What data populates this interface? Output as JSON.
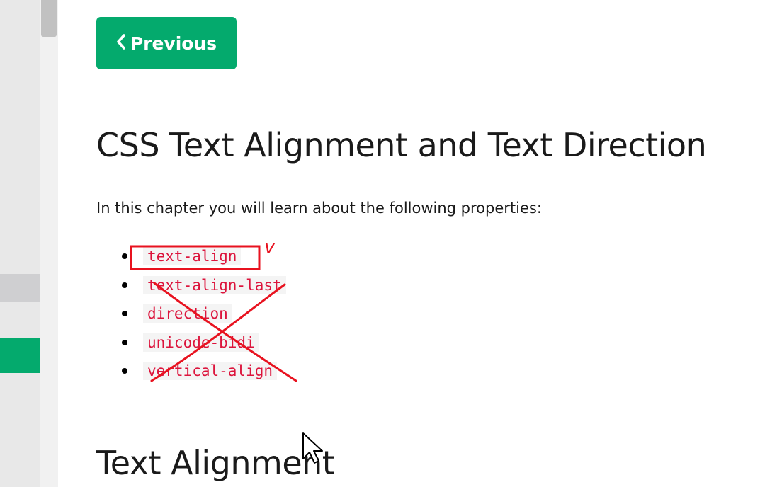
{
  "nav": {
    "previous_label": "Previous",
    "previous_icon": "chevron-left-icon"
  },
  "main": {
    "title": "CSS Text Alignment and Text Direction",
    "intro": "In this chapter you will learn about the following properties:",
    "properties": [
      "text-align",
      "text-align-last",
      "direction",
      "unicode-bidi",
      "vertical-align"
    ],
    "next_heading": "Text Alignment"
  },
  "annotation": {
    "checkmark_text": "v",
    "ink_color": "#e8121f"
  },
  "colors": {
    "accent": "#04aa6d",
    "code_text": "#dc143c",
    "code_background": "#f4f4f4",
    "sidebar_background": "#e8e8e8"
  }
}
